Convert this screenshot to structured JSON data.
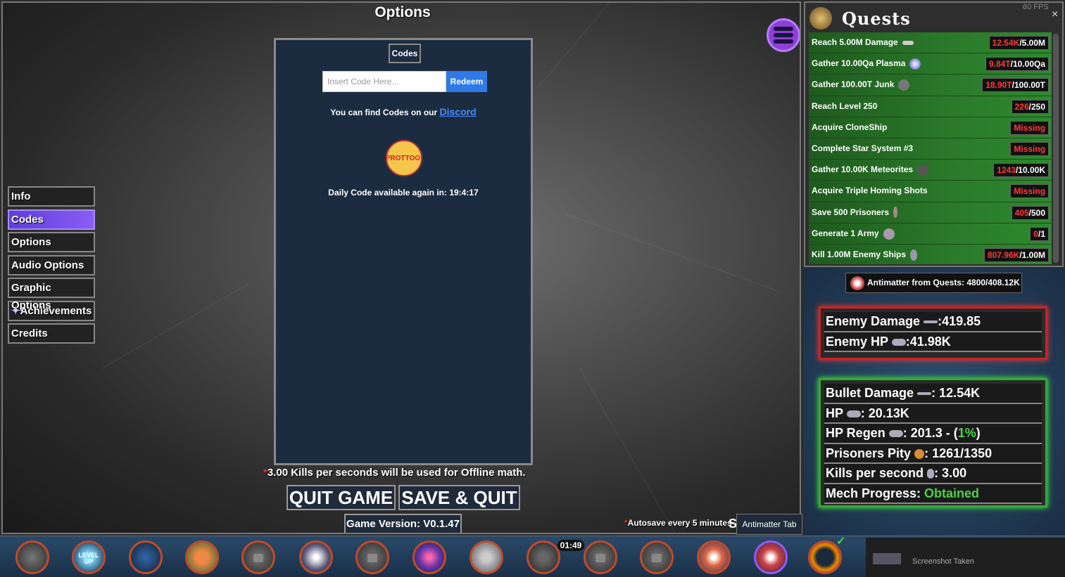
{
  "header": {
    "title": "Options",
    "fps": "60 FPS"
  },
  "nav": {
    "items": [
      {
        "label": "Info"
      },
      {
        "label": "Codes"
      },
      {
        "label": "Options"
      },
      {
        "label": "Audio Options"
      },
      {
        "label": "Graphic Options"
      },
      {
        "label": "Achievements"
      },
      {
        "label": "Credits"
      }
    ],
    "active": "Codes"
  },
  "codes_panel": {
    "tab_label": "Codes",
    "input_placeholder": "Insert Code Here...",
    "redeem_label": "Redeem",
    "find_text": "You can find Codes on our",
    "discord_link": "Discord",
    "proto_logo": "PROTTOO!",
    "daily_text": "Daily Code available again in: 19:4:17"
  },
  "footer": {
    "offline_asterisk": "*",
    "offline_text": "3.00 Kills per seconds will be used for Offline math.",
    "quit_label": "QUIT GAME",
    "save_quit_label": "SAVE & QUIT",
    "version": "Game Version: V0.1.47",
    "autosave_asterisk": "*",
    "autosave_text": "Autosave every 5 minutes",
    "save_mini": "S",
    "tooltip": "Antimatter Tab"
  },
  "quests": {
    "title": "Quests",
    "close": "×",
    "items": [
      {
        "label": "Reach 5.00M Damage",
        "current": "12.54K",
        "target": "/5.00M",
        "icon": "bullet-icon"
      },
      {
        "label": "Gather 10.00Qa Plasma",
        "current": "9.84T",
        "target": "/10.00Qa",
        "icon": "plasma-icon"
      },
      {
        "label": "Gather 100.00T Junk",
        "current": "18.90T",
        "target": "/100.00T",
        "icon": "junk-icon"
      },
      {
        "label": "Reach Level 250",
        "current": "226",
        "target": "/250"
      },
      {
        "label": "Acquire CloneShip",
        "missing": "Missing"
      },
      {
        "label": "Complete Star System #3",
        "missing": "Missing"
      },
      {
        "label": "Gather 10.00K Meteorites",
        "current": "1243",
        "target": "/10.00K",
        "icon": "meteorite-icon"
      },
      {
        "label": "Acquire Triple Homing Shots",
        "missing": "Missing"
      },
      {
        "label": "Save 500 Prisoners",
        "current": "405",
        "target": "/500",
        "icon": "prisoner-icon"
      },
      {
        "label": "Generate 1 Army",
        "current": "0",
        "target": "/1",
        "icon": "army-icon"
      },
      {
        "label": "Kill 1.00M Enemy Ships",
        "current": "807.96K",
        "target": "/1.00M",
        "icon": "enemy-ship-icon"
      }
    ]
  },
  "antimatter": {
    "text": "Antimatter from Quests: 4800/408.12K"
  },
  "enemy_stats": {
    "damage_label": "Enemy Damage",
    "damage_value": ":419.85",
    "hp_label": "Enemy HP",
    "hp_value": ":41.98K"
  },
  "player_stats": {
    "bullet_label": "Bullet Damage",
    "bullet_value": ": 12.54K",
    "hp_label": "HP",
    "hp_value": ": 20.13K",
    "regen_label": "HP Regen",
    "regen_value": ": 201.3 - (",
    "regen_pct": "1%",
    "regen_close": ")",
    "pity_label": "Prisoners Pity",
    "pity_value": ": 1261/1350",
    "kps_label": "Kills per second",
    "kps_value": ": 3.00",
    "mech_label": "Mech Progress: ",
    "mech_value": "Obtained"
  },
  "bottom_bar": {
    "timer": "01:49",
    "level_up": "LEVEL UP",
    "check": "✓",
    "screenshot_text": "Screenshot Taken"
  }
}
